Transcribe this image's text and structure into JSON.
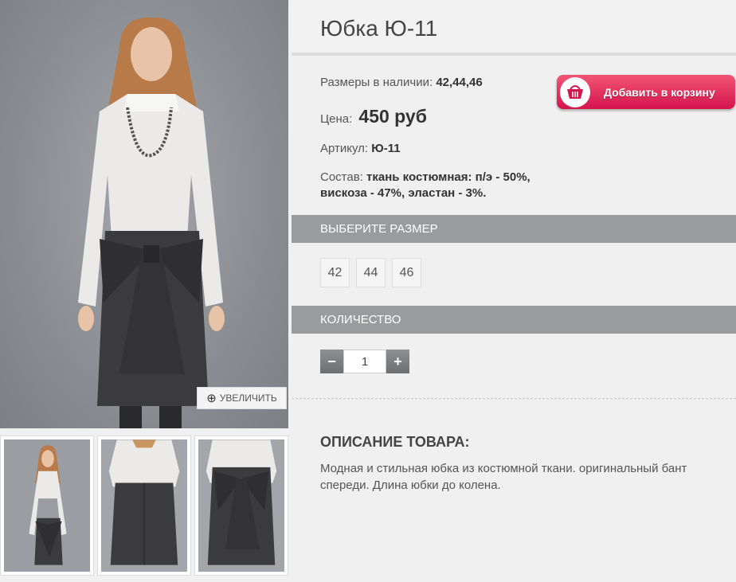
{
  "product": {
    "title": "Юбка Ю-11",
    "sizes_label": "Размеры в наличии:",
    "sizes_value": "42,44,46",
    "price_label": "Цена:",
    "price_value": "450 руб",
    "sku_label": "Артикул:",
    "sku_value": "Ю-11",
    "composition_label": "Состав:",
    "composition_value": "ткань костюмная: п/э - 50%, вискоза - 47%, эластан - 3%."
  },
  "cart": {
    "button_label": "Добавить в корзину",
    "icon": "basket-icon"
  },
  "gallery": {
    "zoom_label": "УВЕЛИЧИТЬ",
    "zoom_icon": "magnifier-plus-icon"
  },
  "size_section": {
    "title": "ВЫБЕРИТЕ РАЗМЕР",
    "options": [
      "42",
      "44",
      "46"
    ]
  },
  "qty_section": {
    "title": "КОЛИЧЕСТВО",
    "minus": "−",
    "plus": "+",
    "value": "1"
  },
  "description": {
    "title": "ОПИСАНИЕ ТОВАРА:",
    "text": "Модная и стильная юбка из костюмной ткани. оригинальный бант спереди. Длина юбки до колена."
  },
  "colors": {
    "cart_button": "#e0245a",
    "section_bar": "#9a9b9d",
    "skirt": "#3b3b3d"
  }
}
